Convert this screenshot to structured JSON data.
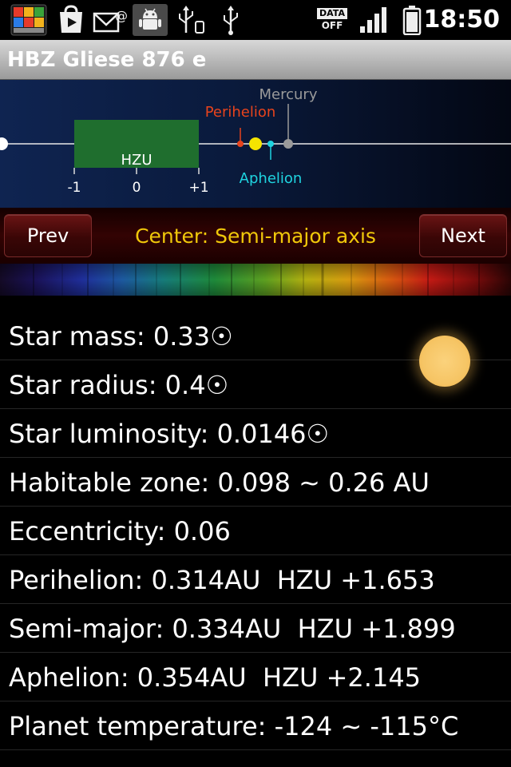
{
  "status_bar": {
    "time": "18:50",
    "data_line1": "DATA",
    "data_line2": "OFF",
    "icons": [
      "avg-icon",
      "play-store-icon",
      "missed-mail-icon",
      "android-debug-icon",
      "usb-icon",
      "usb-icon"
    ]
  },
  "app": {
    "title": "HBZ Gliese 876 e"
  },
  "diagram": {
    "hzu_label": "HZU",
    "ticks": [
      "-1",
      "0",
      "+1"
    ],
    "perihelion_label": "Perihelion",
    "aphelion_label": "Aphelion",
    "mercury_label": "Mercury",
    "colors": {
      "hzu_box": "#1f6e2e",
      "perihelion": "#e8431c",
      "planet": "#f5e400",
      "aphelion": "#1fd4e0",
      "mercury": "#9a9a9a"
    }
  },
  "nav": {
    "prev_label": "Prev",
    "next_label": "Next",
    "center_label": "Center: Semi-major axis"
  },
  "info": {
    "star_mass": "Star mass: 0.33☉",
    "star_radius": "Star radius: 0.4☉",
    "star_luminosity": "Star luminosity: 0.0146☉",
    "habitable_zone": "Habitable zone: 0.098 ~ 0.26 AU",
    "eccentricity": "Eccentricity: 0.06",
    "perihelion": "Perihelion: 0.314AU  HZU +1.653",
    "semi_major": "Semi-major: 0.334AU  HZU +1.899",
    "aphelion": "Aphelion: 0.354AU  HZU +2.145",
    "planet_temperature": "Planet temperature: -124 ~ -115°C"
  },
  "star_color": "#f6c565"
}
